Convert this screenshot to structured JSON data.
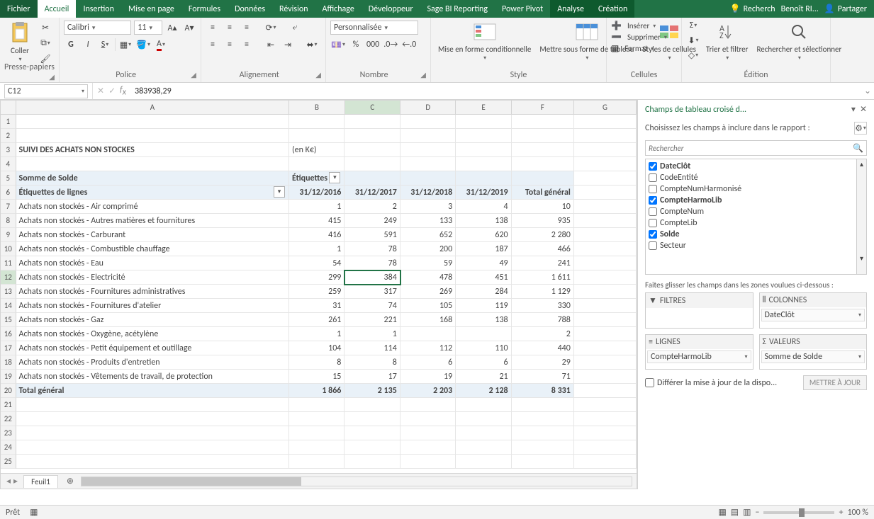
{
  "tabs": {
    "file": "Fichier",
    "home": "Accueil",
    "insert": "Insertion",
    "layout": "Mise en page",
    "formulas": "Formules",
    "data": "Données",
    "review": "Révision",
    "view": "Affichage",
    "developer": "Développeur",
    "sage": "Sage BI Reporting",
    "powerpivot": "Power Pivot",
    "analyze": "Analyse",
    "design": "Création"
  },
  "titleRight": {
    "search": "Recherch",
    "user": "Benoît RI...",
    "share": "Partager"
  },
  "ribbon": {
    "paste": "Coller",
    "clipboard": "Presse-papiers",
    "font": "Police",
    "alignment": "Alignement",
    "number": "Nombre",
    "style": "Style",
    "cells": "Cellules",
    "editing": "Édition",
    "font_name": "Calibri",
    "font_size": "11",
    "number_format": "Personnalisée",
    "wrap": "Mise en forme\nconditionnelle",
    "table_format": "Mettre sous forme\nde tableau",
    "cell_styles": "Styles de\ncellules",
    "insert": "Insérer",
    "delete": "Supprimer",
    "format": "Format",
    "sort": "Trier et\nfiltrer",
    "find": "Rechercher et\nsélectionner"
  },
  "namebox": "C12",
  "formula": "383938,29",
  "columns": [
    "A",
    "B",
    "C",
    "D",
    "E",
    "F",
    "G"
  ],
  "report_title": "SUIVI DES ACHATS NON STOCKES",
  "report_unit": "(en K€)",
  "pivot_value_label": "Somme de Solde",
  "col_header_label": "Étiquettes",
  "row_header_label": "Étiquettes de lignes",
  "dates": [
    "31/12/2016",
    "31/12/2017",
    "31/12/2018",
    "31/12/2019"
  ],
  "total_label": "Total général",
  "rows": [
    {
      "label": "Achats non stockés - Air comprimé",
      "v": [
        "1",
        "2",
        "3",
        "4",
        "10"
      ]
    },
    {
      "label": "Achats non stockés - Autres matières et fournitures",
      "v": [
        "415",
        "249",
        "133",
        "138",
        "935"
      ]
    },
    {
      "label": "Achats non stockés - Carburant",
      "v": [
        "416",
        "591",
        "652",
        "620",
        "2 280"
      ]
    },
    {
      "label": "Achats non stockés - Combustible chauffage",
      "v": [
        "1",
        "78",
        "200",
        "187",
        "466"
      ]
    },
    {
      "label": "Achats non stockés - Eau",
      "v": [
        "54",
        "78",
        "59",
        "49",
        "241"
      ]
    },
    {
      "label": "Achats non stockés - Electricité",
      "v": [
        "299",
        "384",
        "478",
        "451",
        "1 611"
      ]
    },
    {
      "label": "Achats non stockés - Fournitures administratives",
      "v": [
        "259",
        "317",
        "269",
        "284",
        "1 129"
      ]
    },
    {
      "label": "Achats non stockés - Fournitures d'atelier",
      "v": [
        "31",
        "74",
        "105",
        "119",
        "330"
      ]
    },
    {
      "label": "Achats non stockés - Gaz",
      "v": [
        "261",
        "221",
        "168",
        "138",
        "788"
      ]
    },
    {
      "label": "Achats non stockés - Oxygène, acétylène",
      "v": [
        "1",
        "1",
        "",
        "",
        "2"
      ]
    },
    {
      "label": "Achats non stockés - Petit équipement et outillage",
      "v": [
        "104",
        "114",
        "112",
        "110",
        "440"
      ]
    },
    {
      "label": "Achats non stockés - Produits d'entretien",
      "v": [
        "8",
        "8",
        "6",
        "6",
        "29"
      ]
    },
    {
      "label": "Achats non stockés - Vêtements de travail, de protection",
      "v": [
        "15",
        "17",
        "19",
        "21",
        "71"
      ]
    }
  ],
  "totals": [
    "1 866",
    "2 135",
    "2 203",
    "2 128",
    "8 331"
  ],
  "sheet_name": "Feuil1",
  "status_ready": "Prêt",
  "zoom": "100 %",
  "taskpane": {
    "title": "Champs de tableau croisé d...",
    "instruction": "Choisissez les champs à inclure dans le rapport :",
    "search_placeholder": "Rechercher",
    "fields": [
      {
        "name": "DateClôt",
        "checked": true
      },
      {
        "name": "CodeEntité",
        "checked": false
      },
      {
        "name": "CompteNumHarmonisé",
        "checked": false
      },
      {
        "name": "CompteHarmoLib",
        "checked": true
      },
      {
        "name": "CompteNum",
        "checked": false
      },
      {
        "name": "CompteLib",
        "checked": false
      },
      {
        "name": "Solde",
        "checked": true
      },
      {
        "name": "Secteur",
        "checked": false
      }
    ],
    "drag_label": "Faites glisser les champs dans les zones voulues ci-dessous :",
    "areas": {
      "filters": "FILTRES",
      "columns": "COLONNES",
      "rows": "LIGNES",
      "values": "VALEURS"
    },
    "area_items": {
      "columns": "DateClôt",
      "rows": "CompteHarmoLib",
      "values": "Somme de Solde"
    },
    "defer": "Différer la mise à jour de la dispo...",
    "update": "METTRE À JOUR"
  }
}
